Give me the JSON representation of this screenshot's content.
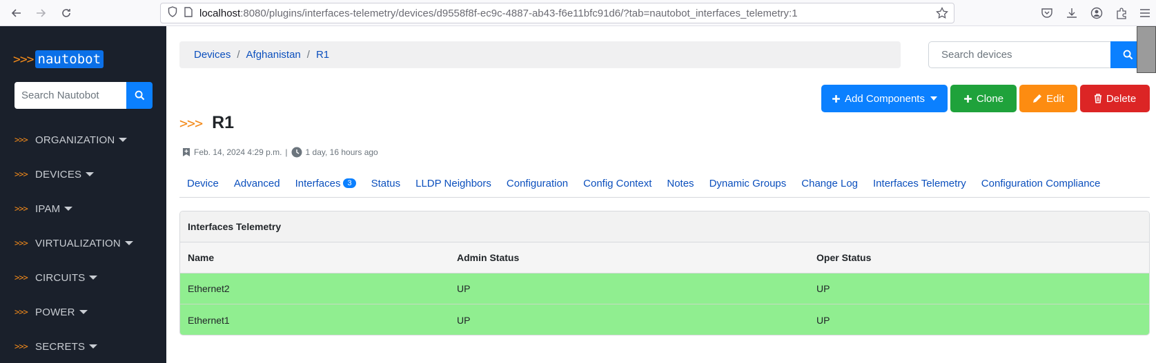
{
  "browser": {
    "url_host": "localhost",
    "url_path": ":8080/plugins/interfaces-telemetry/devices/d9558f8f-ec9c-4887-ab43-f6e11bfc91d6/?tab=nautobot_interfaces_telemetry:1"
  },
  "sidebar": {
    "logo_arrows": ">>>",
    "logo_text": "nautobot",
    "search_placeholder": "Search Nautobot",
    "items": [
      {
        "arrows": ">>>",
        "label": "ORGANIZATION"
      },
      {
        "arrows": ">>>",
        "label": "DEVICES"
      },
      {
        "arrows": ">>>",
        "label": "IPAM"
      },
      {
        "arrows": ">>>",
        "label": "VIRTUALIZATION"
      },
      {
        "arrows": ">>>",
        "label": "CIRCUITS"
      },
      {
        "arrows": ">>>",
        "label": "POWER"
      },
      {
        "arrows": ">>>",
        "label": "SECRETS"
      }
    ]
  },
  "breadcrumb": {
    "items": [
      "Devices",
      "Afghanistan",
      "R1"
    ],
    "separator": "/"
  },
  "search": {
    "placeholder": "Search devices"
  },
  "actions": {
    "add_components": "Add Components",
    "clone": "Clone",
    "edit": "Edit",
    "delete": "Delete"
  },
  "page": {
    "title_arrows": ">>>",
    "title": "R1",
    "created": "Feb. 14, 2024 4:29 p.m.",
    "separator": "|",
    "updated": "1 day, 16 hours ago"
  },
  "tabs": [
    {
      "label": "Device"
    },
    {
      "label": "Advanced"
    },
    {
      "label": "Interfaces",
      "badge": "3"
    },
    {
      "label": "Status"
    },
    {
      "label": "LLDP Neighbors"
    },
    {
      "label": "Configuration"
    },
    {
      "label": "Config Context"
    },
    {
      "label": "Notes"
    },
    {
      "label": "Dynamic Groups"
    },
    {
      "label": "Change Log"
    },
    {
      "label": "Interfaces Telemetry"
    },
    {
      "label": "Configuration Compliance"
    }
  ],
  "panel": {
    "title": "Interfaces Telemetry",
    "columns": [
      "Name",
      "Admin Status",
      "Oper Status"
    ],
    "rows": [
      [
        "Ethernet2",
        "UP",
        "UP"
      ],
      [
        "Ethernet1",
        "UP",
        "UP"
      ]
    ]
  },
  "colors": {
    "sidebar_bg": "#1a202b",
    "accent_orange": "#f38a1a",
    "primary_blue": "#0b80ff",
    "row_ok_green": "#90ee90"
  }
}
